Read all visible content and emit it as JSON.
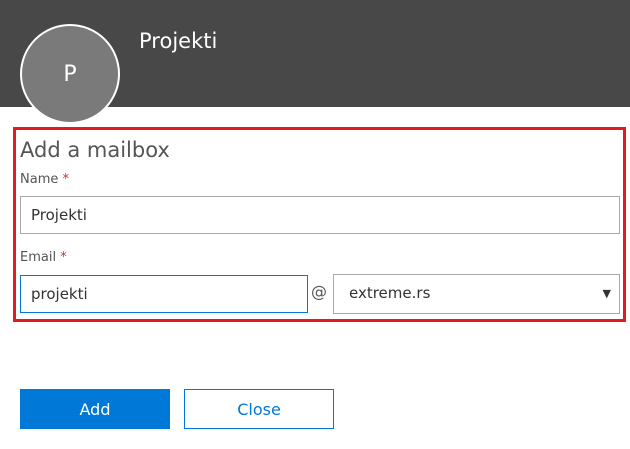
{
  "header": {
    "title": "Projekti",
    "avatar_initial": "P"
  },
  "form": {
    "title": "Add a mailbox",
    "name_label": "Name",
    "name_value": "Projekti",
    "email_label": "Email",
    "email_value": "projekti",
    "required_marker": "*",
    "at_sign": "@",
    "domain_selected": "extreme.rs",
    "dropdown_glyph": "▼"
  },
  "buttons": {
    "add_label": "Add",
    "close_label": "Close"
  },
  "colors": {
    "header_bg": "#484848",
    "accent": "#0078d7",
    "highlight_border": "#e01b24",
    "required": "#c2332e"
  }
}
